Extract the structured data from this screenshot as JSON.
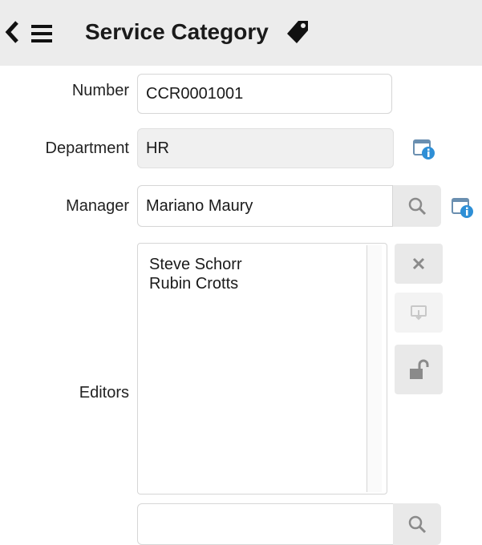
{
  "header": {
    "title": "Service Category"
  },
  "form": {
    "number": {
      "label": "Number",
      "value": "CCR0001001"
    },
    "department": {
      "label": "Department",
      "value": "HR"
    },
    "manager": {
      "label": "Manager",
      "value": "Mariano Maury"
    },
    "editors": {
      "label": "Editors",
      "items": [
        "Steve Schorr",
        "Rubin Crotts"
      ],
      "input_value": ""
    }
  },
  "icons": {
    "back": "chevron-left-icon",
    "menu": "hamburger-menu-icon",
    "tag": "tag-icon",
    "search": "search-icon",
    "info": "reference-info-icon",
    "remove": "close-icon",
    "add_me": "add-me-icon",
    "unlock": "unlock-icon"
  },
  "colors": {
    "header_bg": "#ececec",
    "info_blue": "#2e8fd6",
    "button_bg": "#e9e9e9"
  }
}
